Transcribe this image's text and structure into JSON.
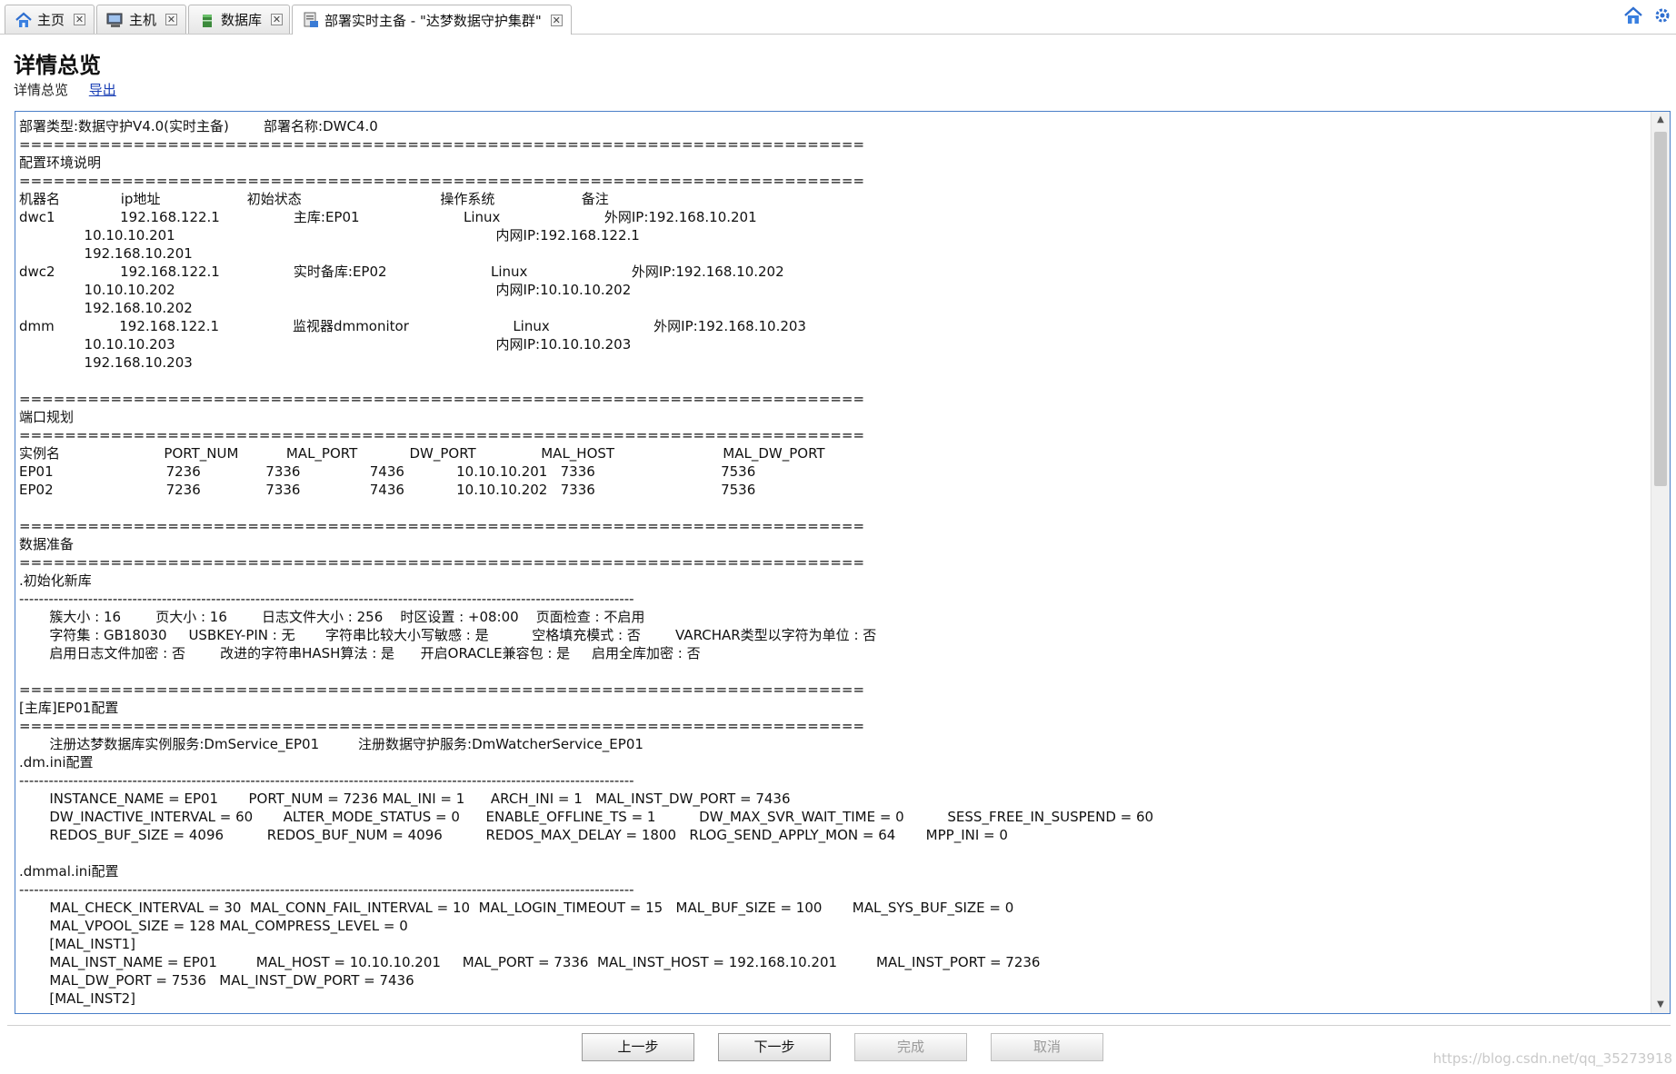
{
  "tabs": [
    {
      "label": "主页",
      "icon": "home-icon"
    },
    {
      "label": "主机",
      "icon": "computer-icon"
    },
    {
      "label": "数据库",
      "icon": "database-icon"
    },
    {
      "label": "部署实时主备 - \"达梦数据守护集群\"",
      "icon": "deploy-icon"
    }
  ],
  "header": {
    "title": "详情总览",
    "breadcrumb": "详情总览",
    "export_link": "导出"
  },
  "detail_lines": [
    "部署类型:数据守护V4.0(实时主备)        部署名称:DWC4.0",
    "==========================================================================",
    "配置环境说明",
    "==========================================================================",
    "机器名              ip地址                    初始状态                                操作系统                    备注",
    "dwc1               192.168.122.1                 主库:EP01                        Linux                        外网IP:192.168.10.201",
    "               10.10.10.201                                                                          内网IP:192.168.122.1",
    "               192.168.10.201",
    "dwc2               192.168.122.1                 实时备库:EP02                        Linux                        外网IP:192.168.10.202",
    "               10.10.10.202                                                                          内网IP:10.10.10.202",
    "               192.168.10.202",
    "dmm               192.168.122.1                 监视器dmmonitor                        Linux                        外网IP:192.168.10.203",
    "               10.10.10.203                                                                          内网IP:10.10.10.203",
    "               192.168.10.203",
    "",
    "==========================================================================",
    "端口规划",
    "==========================================================================",
    "实例名                        PORT_NUM           MAL_PORT            DW_PORT               MAL_HOST                         MAL_DW_PORT",
    "EP01                          7236               7336                7436            10.10.10.201   7336                             7536",
    "EP02                          7236               7336                7436            10.10.10.202   7336                             7536",
    "",
    "==========================================================================",
    "数据准备",
    "==========================================================================",
    ".初始化新库",
    "-----------------------------------------------------------------------------------------------------------------------------",
    "       簇大小 : 16        页大小 : 16        日志文件大小 : 256    时区设置 : +08:00    页面检查 : 不启用",
    "       字符集 : GB18030     USBKEY-PIN : 无       字符串比较大小写敏感 : 是          空格填充模式 : 否        VARCHAR类型以字符为单位 : 否",
    "       启用日志文件加密 : 否        改进的字符串HASH算法 : 是      开启ORACLE兼容包 : 是     启用全库加密 : 否",
    "",
    "==========================================================================",
    "[主库]EP01配置",
    "==========================================================================",
    "       注册达梦数据库实例服务:DmService_EP01         注册数据守护服务:DmWatcherService_EP01",
    ".dm.ini配置",
    "-----------------------------------------------------------------------------------------------------------------------------",
    "       INSTANCE_NAME = EP01       PORT_NUM = 7236 MAL_INI = 1      ARCH_INI = 1   MAL_INST_DW_PORT = 7436",
    "       DW_INACTIVE_INTERVAL = 60       ALTER_MODE_STATUS = 0      ENABLE_OFFLINE_TS = 1          DW_MAX_SVR_WAIT_TIME = 0          SESS_FREE_IN_SUSPEND = 60",
    "       REDOS_BUF_SIZE = 4096          REDOS_BUF_NUM = 4096          REDOS_MAX_DELAY = 1800   RLOG_SEND_APPLY_MON = 64       MPP_INI = 0",
    "",
    ".dmmal.ini配置",
    "-----------------------------------------------------------------------------------------------------------------------------",
    "       MAL_CHECK_INTERVAL = 30  MAL_CONN_FAIL_INTERVAL = 10  MAL_LOGIN_TIMEOUT = 15   MAL_BUF_SIZE = 100       MAL_SYS_BUF_SIZE = 0",
    "       MAL_VPOOL_SIZE = 128 MAL_COMPRESS_LEVEL = 0",
    "       [MAL_INST1]",
    "       MAL_INST_NAME = EP01         MAL_HOST = 10.10.10.201     MAL_PORT = 7336  MAL_INST_HOST = 192.168.10.201         MAL_INST_PORT = 7236",
    "       MAL_DW_PORT = 7536   MAL_INST_DW_PORT = 7436",
    "       [MAL_INST2]"
  ],
  "buttons": {
    "prev": "上一步",
    "next": "下一步",
    "finish": "完成",
    "cancel": "取消"
  },
  "watermark": "https://blog.csdn.net/qq_35273918"
}
